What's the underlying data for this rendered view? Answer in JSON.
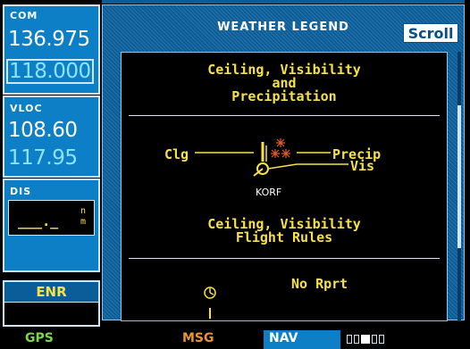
{
  "com": {
    "label": "COM",
    "active": "136.975",
    "standby": "118.000"
  },
  "vloc": {
    "label": "VLOC",
    "active": "108.60",
    "standby": "117.95"
  },
  "dis": {
    "label": "DIS",
    "value": "___._",
    "unit_top": "n",
    "unit_bottom": "m"
  },
  "mode": {
    "label": "ENR"
  },
  "window": {
    "title": "WEATHER LEGEND",
    "scroll_label": "Scroll",
    "section1": {
      "title_line1": "Ceiling, Visibility",
      "title_line2": "and",
      "title_line3": "Precipitation"
    },
    "diagram": {
      "clg": "Clg",
      "precip": "Precip",
      "vis": "Vis",
      "station": "KORF"
    },
    "section2": {
      "title_line1": "Ceiling, Visibility",
      "title_line2": "Flight Rules"
    },
    "no_report": "No Rprt"
  },
  "status": {
    "gps": "GPS",
    "msg": "MSG",
    "nav": "NAV"
  },
  "colors": {
    "accent_blue": "#0c7fc7",
    "legend_yellow": "#f6e14a",
    "msg_orange": "#e89530",
    "gps_green": "#79d948",
    "precip_orange": "#e85a2a"
  }
}
